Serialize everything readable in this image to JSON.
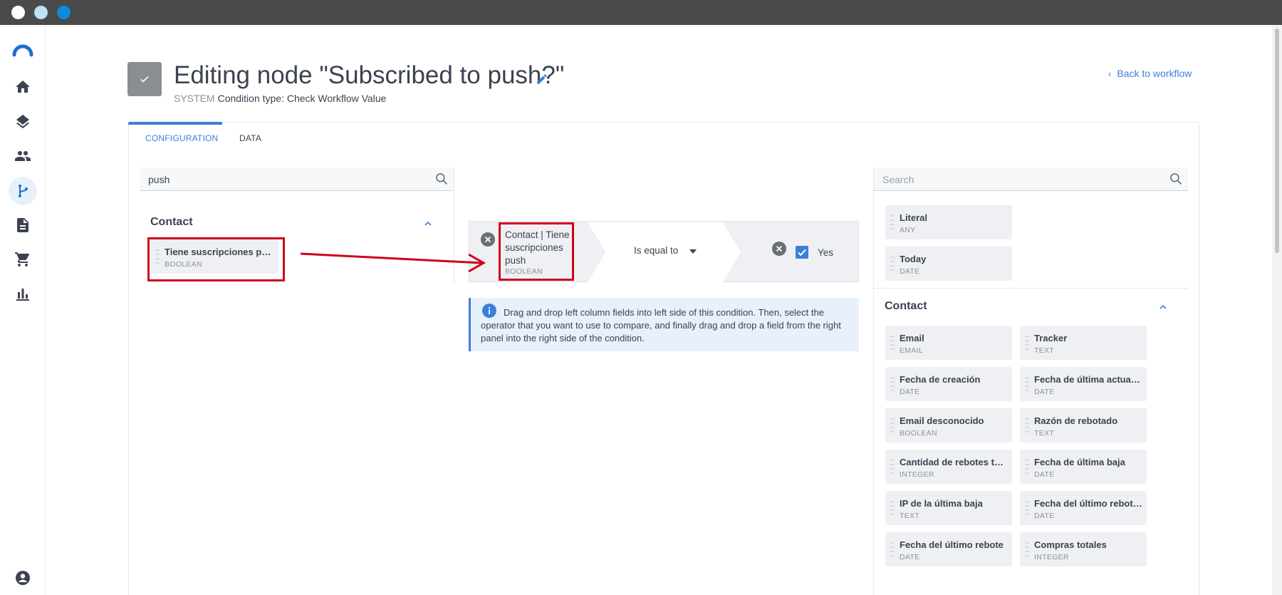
{
  "window": {
    "controls": [
      "close",
      "minimize",
      "maximize"
    ]
  },
  "sidebar": {
    "logo_icon": "app-logo-icon",
    "items": [
      {
        "name": "home",
        "icon": "home-icon"
      },
      {
        "name": "layers",
        "icon": "layers-icon"
      },
      {
        "name": "contacts",
        "icon": "people-icon"
      },
      {
        "name": "workflows",
        "icon": "workflow-branch-icon",
        "active": true
      },
      {
        "name": "documents",
        "icon": "document-icon"
      },
      {
        "name": "store",
        "icon": "cart-icon"
      },
      {
        "name": "reports",
        "icon": "bar-chart-icon"
      }
    ],
    "bottom_icon": "account-icon"
  },
  "header": {
    "title": "Editing node \"Subscribed to push?\"",
    "system_label": "SYSTEM",
    "condition_type": "Condition type: Check Workflow Value",
    "back_label": "Back to workflow"
  },
  "tabs": [
    {
      "label": "CONFIGURATION",
      "active": true
    },
    {
      "label": "DATA",
      "active": false
    }
  ],
  "left_panel": {
    "search_value": "push",
    "group_title": "Contact",
    "fields": [
      {
        "name": "Tiene suscripciones push",
        "type": "BOOLEAN"
      }
    ]
  },
  "condition": {
    "left_field": "Contact | Tiene suscripciones push",
    "left_type": "BOOLEAN",
    "operator": "Is equal to",
    "right_checked": true,
    "right_value": "Yes"
  },
  "info": {
    "text": "Drag and drop left column fields into left side of this condition. Then, select the operator that you want to use to compare, and finally drag and drop a field from the right panel into the right side of the condition."
  },
  "right_panel": {
    "search_placeholder": "Search",
    "literals": [
      {
        "name": "Literal",
        "type": "ANY"
      },
      {
        "name": "Today",
        "type": "DATE"
      }
    ],
    "group_title": "Contact",
    "fields": [
      {
        "name": "Email",
        "type": "EMAIL"
      },
      {
        "name": "Tracker",
        "type": "TEXT"
      },
      {
        "name": "Fecha de creación",
        "type": "DATE"
      },
      {
        "name": "Fecha de última actualización",
        "type": "DATE"
      },
      {
        "name": "Email desconocido",
        "type": "BOOLEAN"
      },
      {
        "name": "Razón de rebotado",
        "type": "TEXT"
      },
      {
        "name": "Cantidad de rebotes temporales",
        "type": "INTEGER"
      },
      {
        "name": "Fecha de última baja",
        "type": "DATE"
      },
      {
        "name": "IP de la última baja",
        "type": "TEXT"
      },
      {
        "name": "Fecha del último rebote temporal",
        "type": "DATE"
      },
      {
        "name": "Fecha del último rebote",
        "type": "DATE"
      },
      {
        "name": "Compras totales",
        "type": "INTEGER"
      }
    ]
  },
  "colors": {
    "accent": "#3c7ed8",
    "highlight": "#d0021b",
    "chip_bg": "#eef0f3"
  }
}
